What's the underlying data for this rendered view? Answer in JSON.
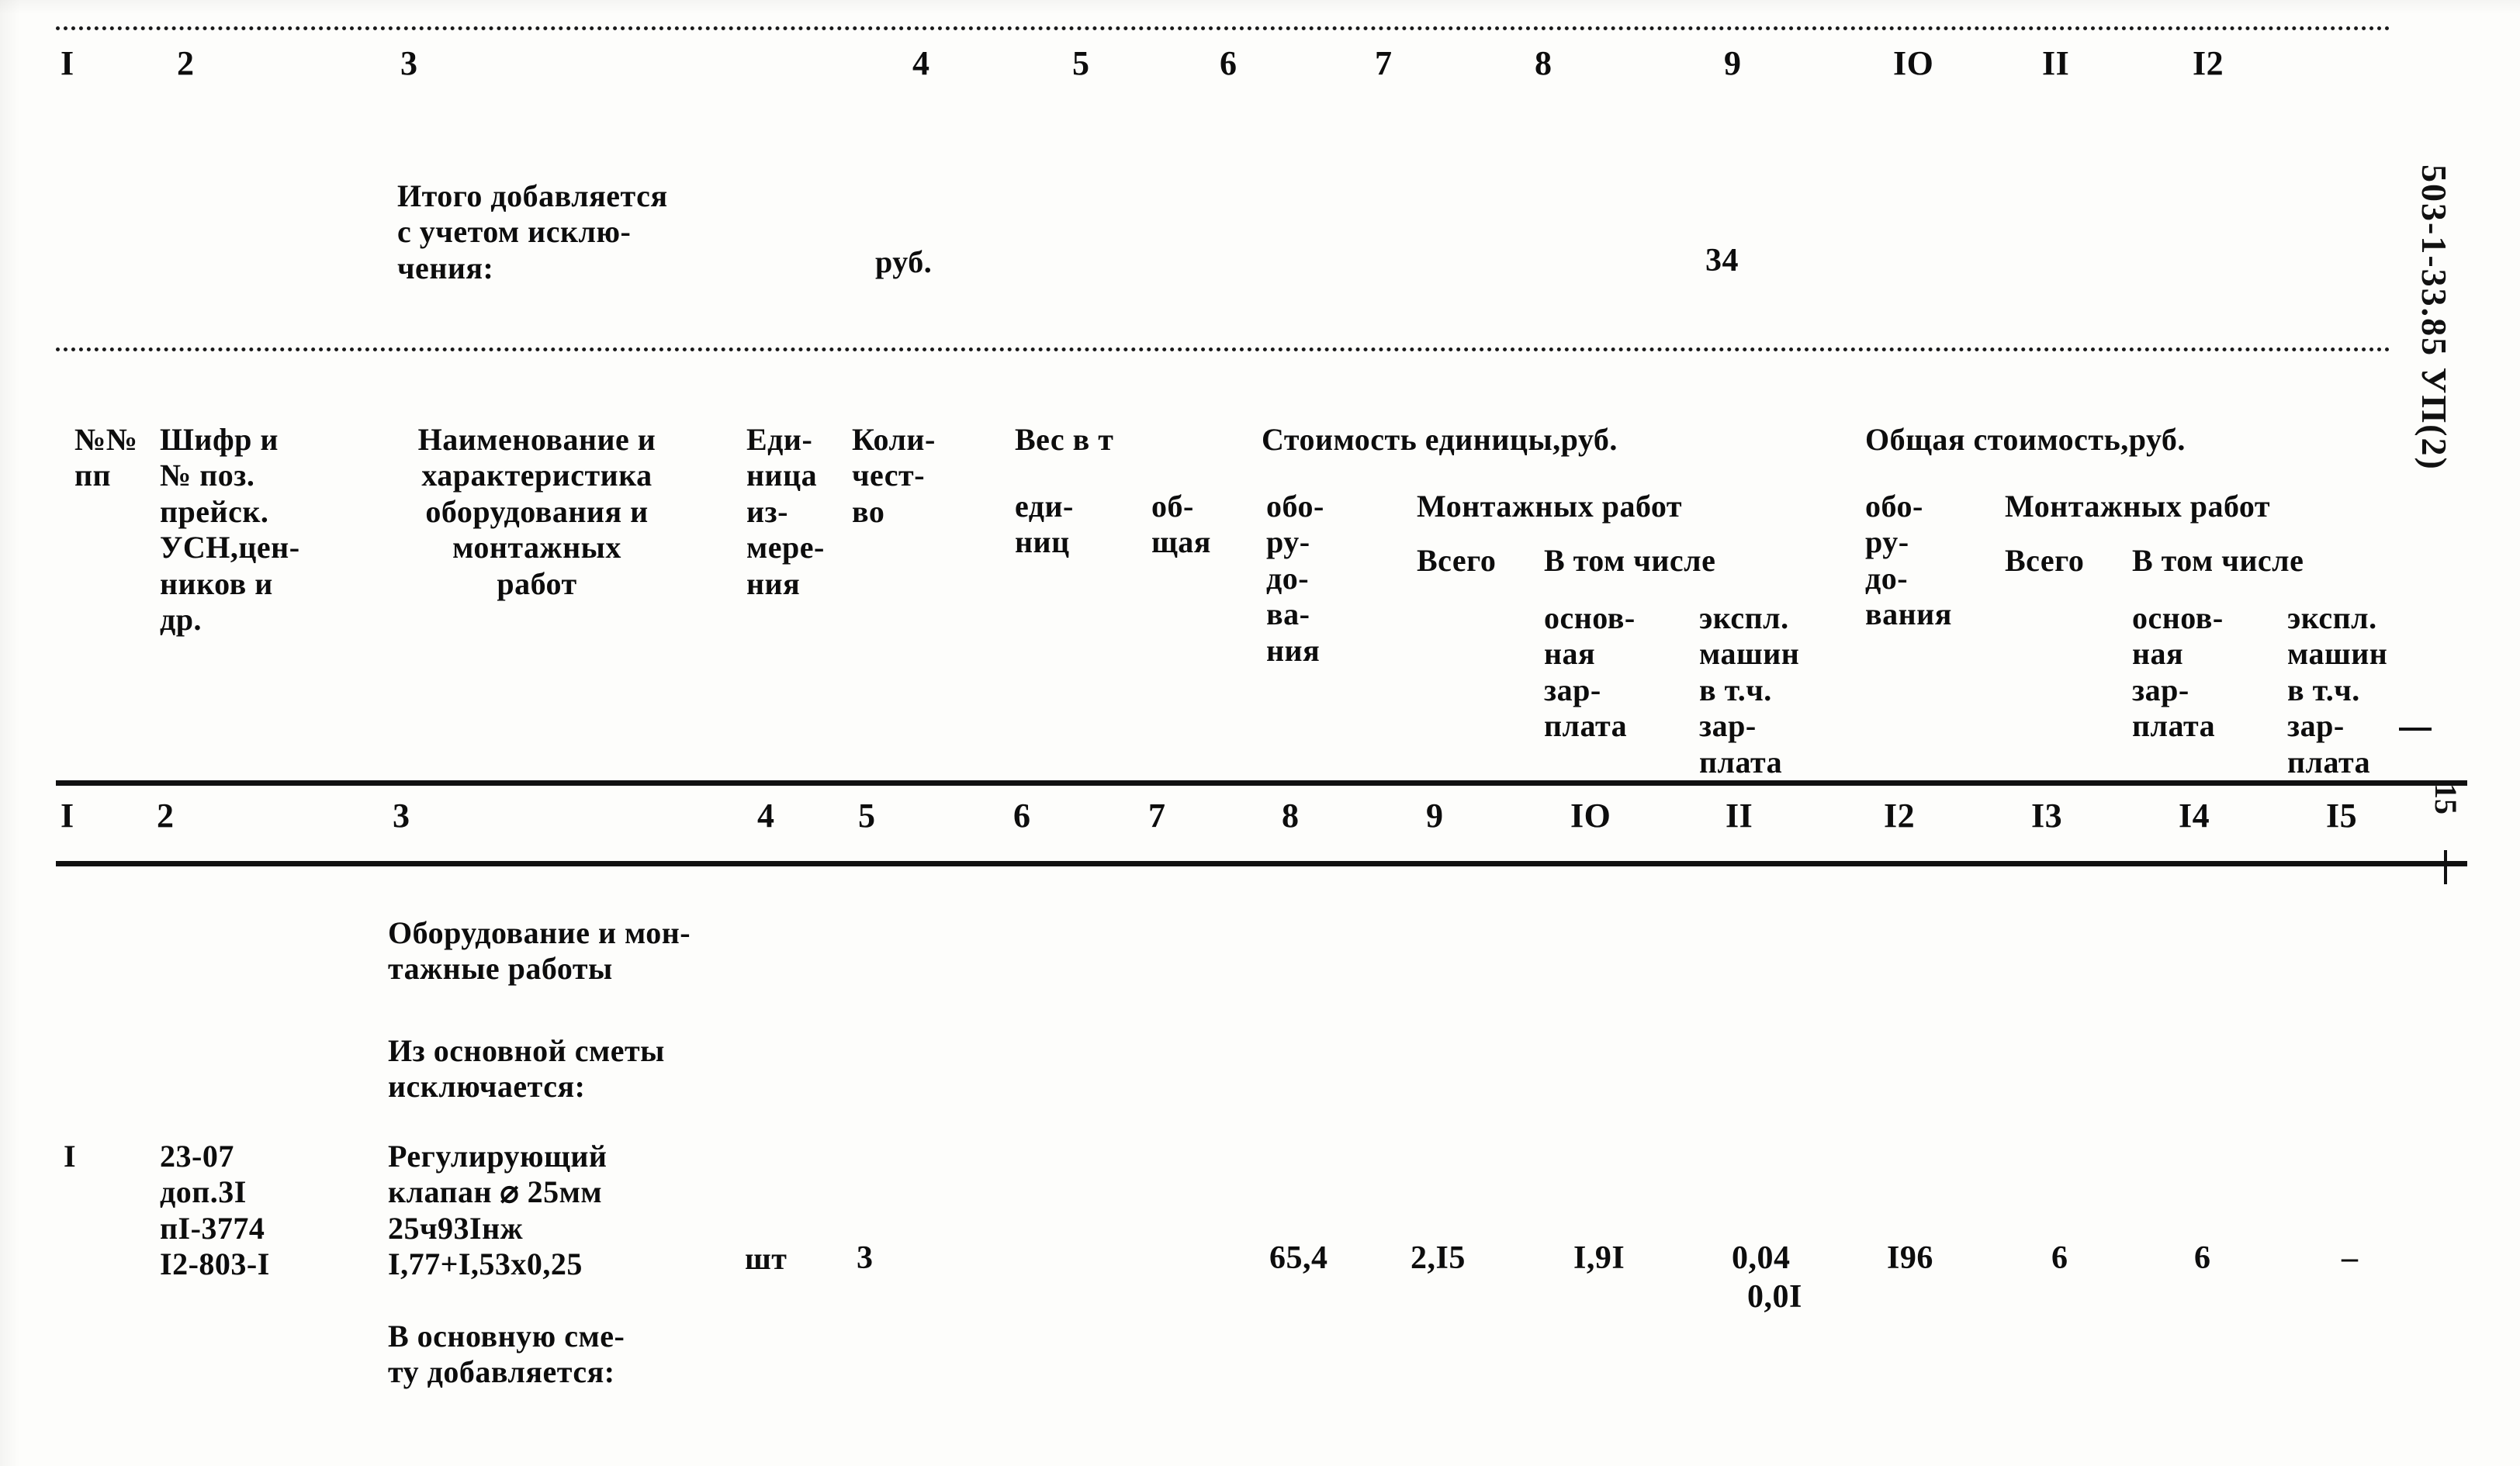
{
  "document": {
    "side_code": "503-1-33.85 УП(2)",
    "side_page_number": "15"
  },
  "top_column_numbers": [
    "I",
    "2",
    "3",
    "4",
    "5",
    "6",
    "7",
    "8",
    "9",
    "IO",
    "II",
    "I2"
  ],
  "subtotal_block": {
    "label": "Итого добавляется\nс учетом исклю-\nчения:",
    "unit": "руб.",
    "value": "34"
  },
  "header": {
    "col1": "№№\nпп",
    "col2": "Шифр и\n№ поз.\nпрейск.\nУСН,цен-\nников и\nдр.",
    "col3": "Наименование и\nхарактеристика\nоборудования и\nмонтажных\nработ",
    "col4": "Еди-\nница\nиз-\nмере-\nния",
    "col5": "Коли-\nчест-\nво",
    "weight_group": "Вес в т",
    "col6": "еди-\nниц",
    "col7": "об-\nщая",
    "unit_cost_group": "Стоимость единицы,руб.",
    "col8": "обо-\nру-\nдо-\nва-\nния",
    "unit_mount_group": "Монтажных работ",
    "col9": "Всего",
    "unit_incl": "В том числе",
    "col10": "основ-\nная\nзар-\nплата",
    "col11": "экспл.\nмашин\nв т.ч.\nзар-\nплата",
    "total_cost_group": "Общая стоимость,руб.",
    "col12": "обо-\nру-\nдо-\nвания",
    "total_mount_group": "Монтажных работ",
    "col13": "Всего",
    "total_incl": "В том числе",
    "col14": "основ-\nная\nзар-\nплата",
    "col15": "экспл.\nмашин\nв т.ч.\nзар-\nплата"
  },
  "body_column_numbers": [
    "I",
    "2",
    "3",
    "4",
    "5",
    "6",
    "7",
    "8",
    "9",
    "IO",
    "II",
    "I2",
    "I3",
    "I4",
    "I5"
  ],
  "body": {
    "section_title": "Оборудование и мон-\n   тажные работы",
    "exclude_caption": "Из основной сметы\nисключается:",
    "add_caption": "В основную сме-\nту добавляется:",
    "rows": [
      {
        "no": "I",
        "code": "23-07\nдоп.3I\nпI-3774\nI2-803-I",
        "description": "Регулирующий\nклапан ⌀ 25мм\n25ч93Iнж\nI,77+I,53х0,25",
        "unit": "шт",
        "qty": "3",
        "weight_unit": "",
        "weight_total": "",
        "unit_equip": "65,4",
        "unit_mount_total": "2,I5",
        "unit_mount_salary": "I,9I",
        "unit_mount_machines": "0,04",
        "unit_mount_machines_sub": "0,0I",
        "total_equip": "I96",
        "total_mount_total": "6",
        "total_mount_salary": "6",
        "total_mount_machines": "–"
      }
    ]
  }
}
